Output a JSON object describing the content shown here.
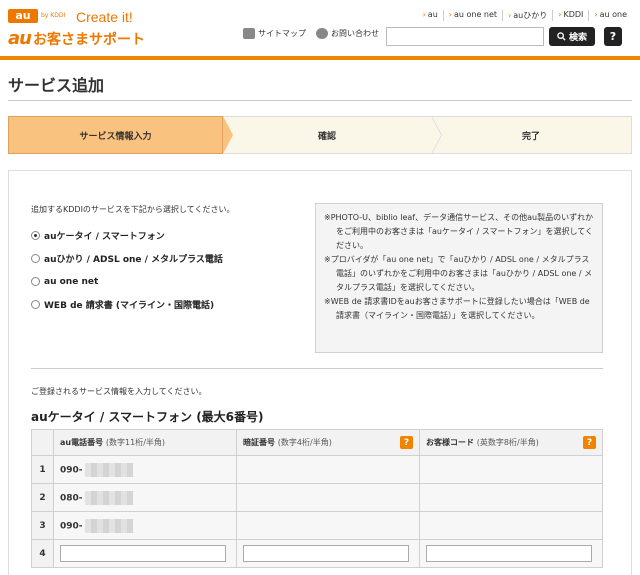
{
  "header": {
    "logo_au": "au",
    "logo_kddi": "by KDDI",
    "logo_tagline": "Create it!",
    "logo_brand_au": "au",
    "logo_brand_text": "お客さまサポート",
    "top_links": [
      "au",
      "au one net",
      "auひかり",
      "KDDI",
      "au one"
    ],
    "sitemap": "サイトマップ",
    "contact": "お問い合わせ",
    "search_placeholder": "",
    "search_button": "検索",
    "help_button": "?"
  },
  "page": {
    "title": "サービス追加"
  },
  "steps": [
    {
      "label": "サービス情報入力",
      "active": true
    },
    {
      "label": "確認",
      "active": false
    },
    {
      "label": "完了",
      "active": false
    }
  ],
  "form": {
    "intro": "追加するKDDIのサービスを下記から選択してください。",
    "options": [
      {
        "label": "auケータイ / スマートフォン",
        "selected": true
      },
      {
        "label": "auひかり / ADSL one / メタルプラス電話",
        "selected": false
      },
      {
        "label": "au one net",
        "selected": false
      },
      {
        "label": "WEB de 請求書 (マイライン・国際電話)",
        "selected": false
      }
    ],
    "notes": [
      "※PHOTO-U、biblio leaf、データ通信サービス、その他au製品のいずれかをご利用中のお客さまは「auケータイ / スマートフォン」を選択してください。",
      "※プロバイダが「au one net」で「auひかり / ADSL one / メタルプラス電話」のいずれかをご利用中のお客さまは「auひかり / ADSL one / メタルプラス電話」を選択してください。",
      "※WEB de 請求書IDをauお客さまサポートに登録したい場合は「WEB de 請求書（マイライン・国際電話）」を選択してください。"
    ],
    "intro2": "ご登録されるサービス情報を入力してください。",
    "section_title": "auケータイ / スマートフォン (最大6番号)"
  },
  "table": {
    "columns": [
      {
        "label": "au電話番号",
        "sub": "(数字11桁/半角)",
        "help": false
      },
      {
        "label": "暗証番号",
        "sub": "(数字4桁/半角)",
        "help": true
      },
      {
        "label": "お客様コード",
        "sub": "(英数字8桁/半角)",
        "help": true
      }
    ],
    "help_icon": "?",
    "rows": [
      {
        "num": "1",
        "phone": "090-"
      },
      {
        "num": "2",
        "phone": "080-"
      },
      {
        "num": "3",
        "phone": "090-"
      },
      {
        "num": "4",
        "phone": ""
      }
    ]
  },
  "colors": {
    "accent": "#f08300",
    "active_step": "#f9c27f",
    "inactive_step": "#fbf7e8"
  }
}
